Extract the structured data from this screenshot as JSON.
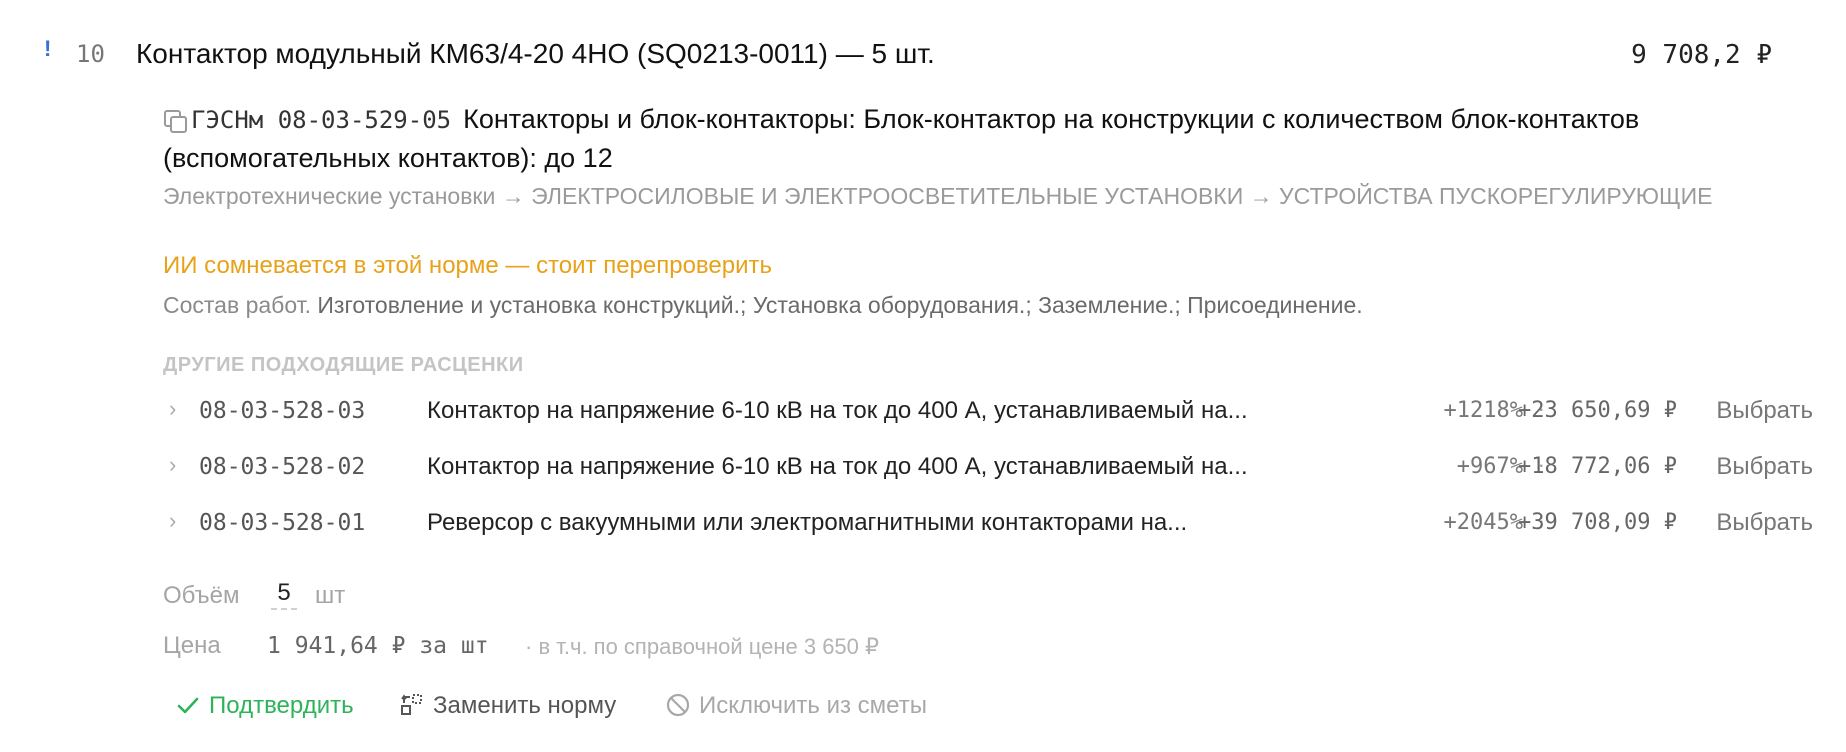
{
  "item": {
    "flag": "!",
    "position": "10",
    "title": "Контактор модульный КМ63/4-20 4НО (SQ0213-0011) — 5 шт.",
    "total": "9 708,2 ₽"
  },
  "norm": {
    "code": "ГЭСНм 08-03-529-05",
    "title": "Контакторы и блок-контакторы: Блок-контактор на конструкции с количеством блок-контактов (вспомогательных контактов): до 12",
    "breadcrumb": "Электротехнические установки → ЭЛЕКТРОСИЛОВЫЕ И ЭЛЕКТРООСВЕТИТЕЛЬНЫЕ УСТАНОВКИ → УСТРОЙСТВА ПУСКОРЕГУЛИРУЮЩИЕ",
    "ai_warning": "ИИ сомневается в этой норме — стоит перепроверить",
    "composition_label": "Состав работ.",
    "composition_text": "Изготовление и установка конструкций.; Установка оборудования.; Заземление.; Присоединение."
  },
  "alternatives": {
    "header": "ДРУГИЕ ПОДХОДЯЩИЕ РАСЦЕНКИ",
    "choose_label": "Выбрать",
    "separator": "·",
    "rows": [
      {
        "code": "08-03-528-03",
        "name": "Контактор на напряжение 6-10 кВ на ток до 400 А, устанавливаемый на...",
        "delta": "+1218%",
        "diff": "+23 650,69 ₽"
      },
      {
        "code": "08-03-528-02",
        "name": "Контактор на напряжение 6-10 кВ на ток до 400 А, устанавливаемый на...",
        "delta": "+967%",
        "diff": "+18 772,06 ₽"
      },
      {
        "code": "08-03-528-01",
        "name": "Реверсор с вакуумными или электромагнитными контакторами на...",
        "delta": "+2045%",
        "diff": "+39 708,09 ₽"
      }
    ]
  },
  "volume": {
    "label": "Объём",
    "value": "5",
    "unit": "шт"
  },
  "price": {
    "label": "Цена",
    "value": "1 941,64 ₽ за шт",
    "reference": "· в т.ч. по справочной цене 3 650 ₽"
  },
  "actions": {
    "confirm": "Подтвердить",
    "replace": "Заменить норму",
    "exclude": "Исключить из сметы"
  },
  "colors": {
    "accent_green": "#2eb35a",
    "warning_orange": "#e8a21a",
    "flag_blue": "#3b6fd8"
  }
}
